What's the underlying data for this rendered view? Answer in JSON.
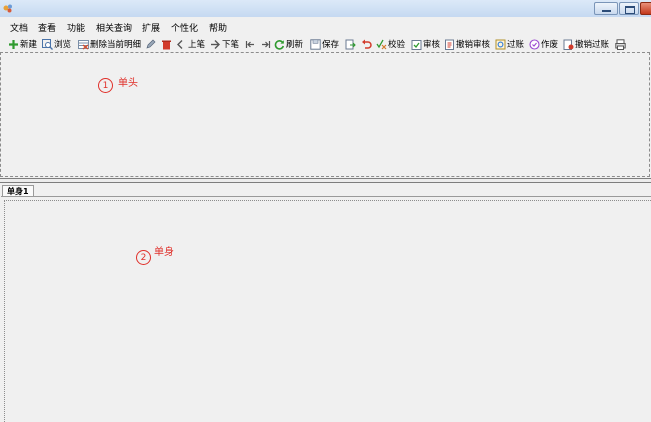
{
  "menu": [
    "文档",
    "查看",
    "功能",
    "相关查询",
    "扩展",
    "个性化",
    "帮助"
  ],
  "toolbar": {
    "new": "新建",
    "browse": "浏览",
    "delete_detail": "删除当前明细",
    "prev": "上笔",
    "next": "下笔",
    "refresh": "刷新",
    "save": "保存",
    "verify": "校验",
    "approve": "审核",
    "cancel_approve": "撤销审核",
    "post": "过账",
    "void": "作废",
    "cancel_post": "撤销过账"
  },
  "header": {
    "marker": "1",
    "label": "单头"
  },
  "tabs": [
    "单身1"
  ],
  "body": {
    "marker": "2",
    "label": "单身"
  },
  "colors": {
    "annotation": "#e0302a",
    "title_bar": "#c5d9f1",
    "close_button": "#c2381c"
  }
}
